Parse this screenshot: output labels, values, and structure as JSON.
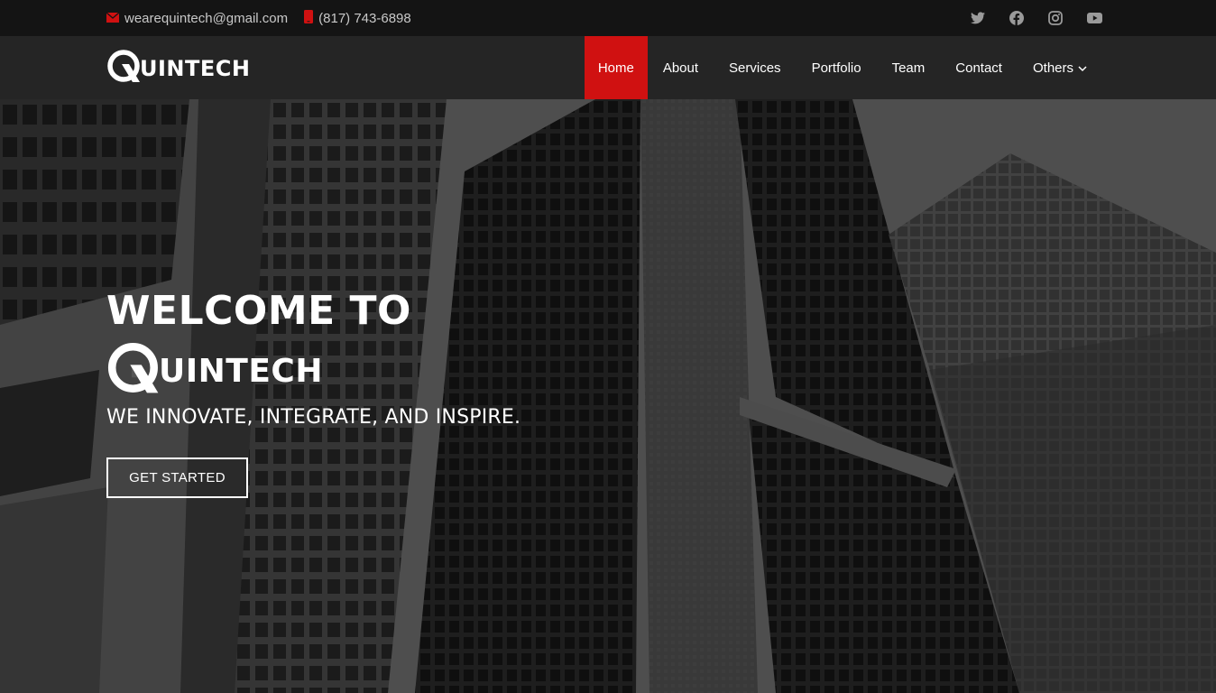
{
  "topbar": {
    "email": "wearequintech@gmail.com",
    "phone": "(817) 743-6898",
    "email_icon": "envelope-icon",
    "phone_icon": "phone-icon",
    "social": [
      "twitter-icon",
      "facebook-icon",
      "instagram-icon",
      "youtube-icon"
    ]
  },
  "header": {
    "logo_text": "UINTECH",
    "nav": [
      {
        "label": "Home",
        "active": true
      },
      {
        "label": "About"
      },
      {
        "label": "Services"
      },
      {
        "label": "Portfolio"
      },
      {
        "label": "Team"
      },
      {
        "label": "Contact"
      },
      {
        "label": "Others",
        "has_dropdown": true
      }
    ]
  },
  "hero": {
    "title": "WELCOME TO",
    "logo_text": "UINTECH",
    "tagline": "WE INNOVATE, INTEGRATE, AND INSPIRE.",
    "cta_label": "GET STARTED"
  },
  "colors": {
    "accent": "#d01111",
    "topbar_bg": "#141414",
    "header_bg": "#252525"
  }
}
